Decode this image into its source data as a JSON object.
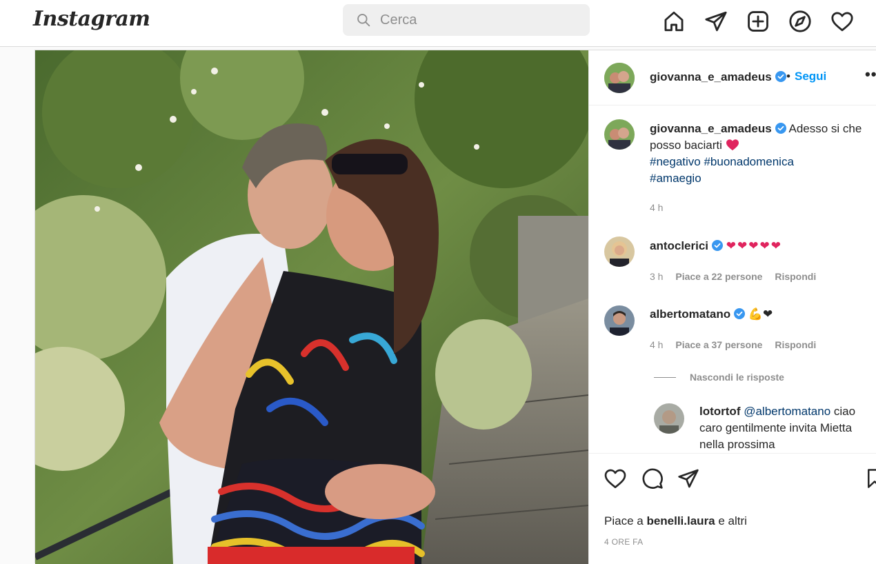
{
  "nav": {
    "logo": "Instagram",
    "search_placeholder": "Cerca",
    "icons": [
      "home-icon",
      "direct-icon",
      "new-post-icon",
      "explore-icon",
      "activity-icon"
    ]
  },
  "post": {
    "author": "giovanna_e_amadeus",
    "follow_label": "Segui",
    "separator": "•",
    "more_label": "•••",
    "caption": {
      "username": "giovanna_e_amadeus",
      "text": "Adesso si che posso baciarti",
      "hashtags": [
        "#negativo",
        "#buonadomenica",
        "#amaegio"
      ],
      "time": "4 h"
    },
    "comments": [
      {
        "username": "antoclerici",
        "text": "❤❤❤❤❤",
        "time": "3 h",
        "likes": "Piace a 22 persone",
        "reply_label": "Rispondi"
      },
      {
        "username": "albertomatano",
        "text": "💪❤",
        "time": "4 h",
        "likes": "Piace a 37 persone",
        "reply_label": "Rispondi"
      }
    ],
    "hide_replies_label": "Nascondi le risposte",
    "reply": {
      "username": "lotortof",
      "mention": "@albertomatano",
      "text": "ciao caro gentilmente invita Mietta nella prossima"
    },
    "likes_prefix": "Piace a",
    "likes_user": "benelli.laura",
    "likes_suffix": "e altri",
    "posted_time": "4 ORE FA"
  },
  "colors": {
    "accent": "#0095f6",
    "verified": "#3897f0",
    "hashtag": "#00376b",
    "heart": "#e0245e"
  }
}
